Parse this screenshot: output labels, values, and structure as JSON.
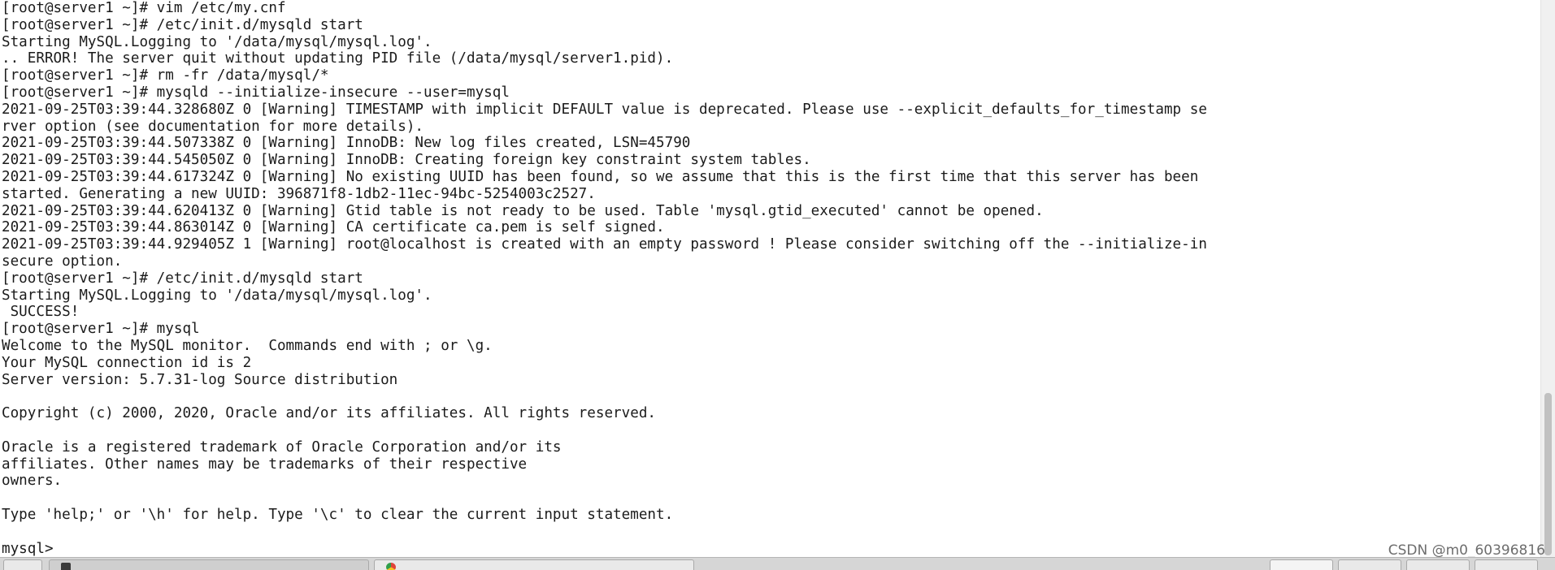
{
  "terminal": {
    "lines": [
      "[root@server1 ~]# vim /etc/my.cnf",
      "[root@server1 ~]# /etc/init.d/mysqld start",
      "Starting MySQL.Logging to '/data/mysql/mysql.log'.",
      ".. ERROR! The server quit without updating PID file (/data/mysql/server1.pid).",
      "[root@server1 ~]# rm -fr /data/mysql/*",
      "[root@server1 ~]# mysqld --initialize-insecure --user=mysql",
      "2021-09-25T03:39:44.328680Z 0 [Warning] TIMESTAMP with implicit DEFAULT value is deprecated. Please use --explicit_defaults_for_timestamp se",
      "rver option (see documentation for more details).",
      "2021-09-25T03:39:44.507338Z 0 [Warning] InnoDB: New log files created, LSN=45790",
      "2021-09-25T03:39:44.545050Z 0 [Warning] InnoDB: Creating foreign key constraint system tables.",
      "2021-09-25T03:39:44.617324Z 0 [Warning] No existing UUID has been found, so we assume that this is the first time that this server has been",
      "started. Generating a new UUID: 396871f8-1db2-11ec-94bc-5254003c2527.",
      "2021-09-25T03:39:44.620413Z 0 [Warning] Gtid table is not ready to be used. Table 'mysql.gtid_executed' cannot be opened.",
      "2021-09-25T03:39:44.863014Z 0 [Warning] CA certificate ca.pem is self signed.",
      "2021-09-25T03:39:44.929405Z 1 [Warning] root@localhost is created with an empty password ! Please consider switching off the --initialize-in",
      "secure option.",
      "[root@server1 ~]# /etc/init.d/mysqld start",
      "Starting MySQL.Logging to '/data/mysql/mysql.log'.",
      " SUCCESS!",
      "[root@server1 ~]# mysql",
      "Welcome to the MySQL monitor.  Commands end with ; or \\g.",
      "Your MySQL connection id is 2",
      "Server version: 5.7.31-log Source distribution",
      "",
      "Copyright (c) 2000, 2020, Oracle and/or its affiliates. All rights reserved.",
      "",
      "Oracle is a registered trademark of Oracle Corporation and/or its",
      "affiliates. Other names may be trademarks of their respective",
      "owners.",
      "",
      "Type 'help;' or '\\h' for help. Type '\\c' to clear the current input statement.",
      "",
      "mysql> "
    ]
  },
  "watermark": "CSDN @m0_60396816",
  "colors": {
    "background": "#ffffff",
    "text": "#1b1b1b",
    "taskbar": "#d6d6d6"
  }
}
